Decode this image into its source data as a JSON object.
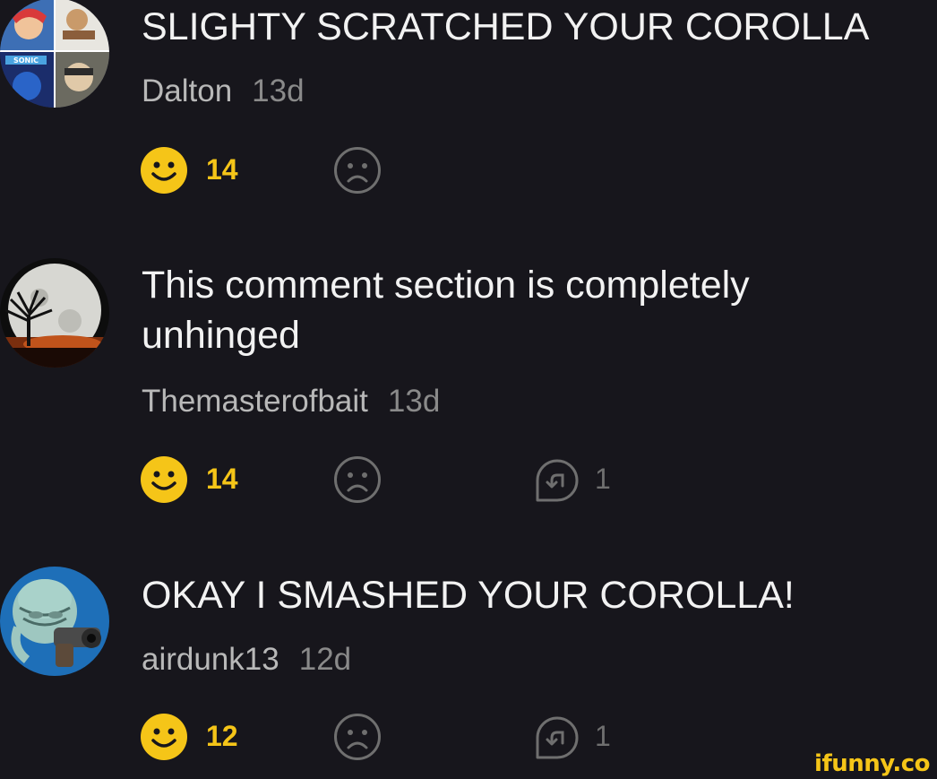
{
  "comments": [
    {
      "text": "SLIGHTY SCRATCHED YOUR COROLLA",
      "user": "Dalton",
      "time": "13d",
      "likes": "14",
      "replies": null,
      "avatar": "sonic-collage-avatar"
    },
    {
      "text": "This comment section is completely unhinged",
      "user": "Themasterofbait",
      "time": "13d",
      "likes": "14",
      "replies": "1",
      "avatar": "tree-moon-avatar"
    },
    {
      "text": "OKAY I SMASHED YOUR COROLLA!",
      "user": "airdunk13",
      "time": "12d",
      "likes": "12",
      "replies": "1",
      "avatar": "squidward-gun-avatar"
    }
  ],
  "avatar_collage_text": "SONIC",
  "watermark": "ifunny.co",
  "colors": {
    "background": "#17161c",
    "smile": "#f5c518",
    "text": "#f2f2f2",
    "muted": "#8a8a8a"
  }
}
